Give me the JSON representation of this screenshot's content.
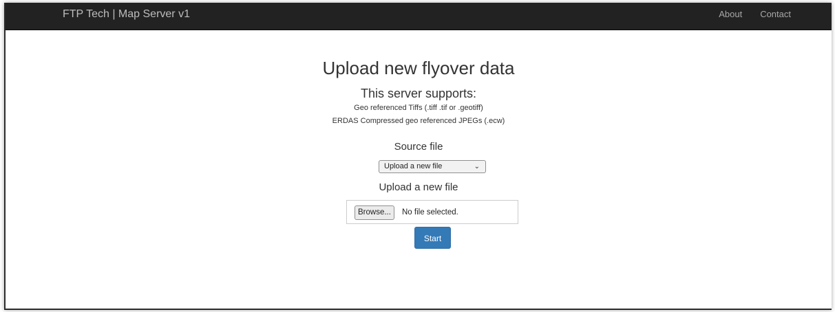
{
  "navbar": {
    "brand": "FTP Tech | Map Server v1",
    "links": [
      {
        "label": "About"
      },
      {
        "label": "Contact"
      }
    ]
  },
  "main": {
    "title": "Upload new flyover data",
    "supports_heading": "This server supports:",
    "formats": [
      "Geo referenced Tiffs (.tiff .tif or .geotiff)",
      "ERDAS Compressed geo referenced JPEGs (.ecw)"
    ],
    "source_file_label": "Source file",
    "source_select": {
      "selected": "Upload a new file"
    },
    "upload_label": "Upload a new file",
    "file_input": {
      "browse_label": "Browse...",
      "status": "No file selected."
    },
    "start_label": "Start"
  },
  "colors": {
    "navbar_bg": "#222222",
    "primary_button": "#337ab7"
  },
  "icons": {
    "select_chevron": "chevron-down-icon"
  }
}
